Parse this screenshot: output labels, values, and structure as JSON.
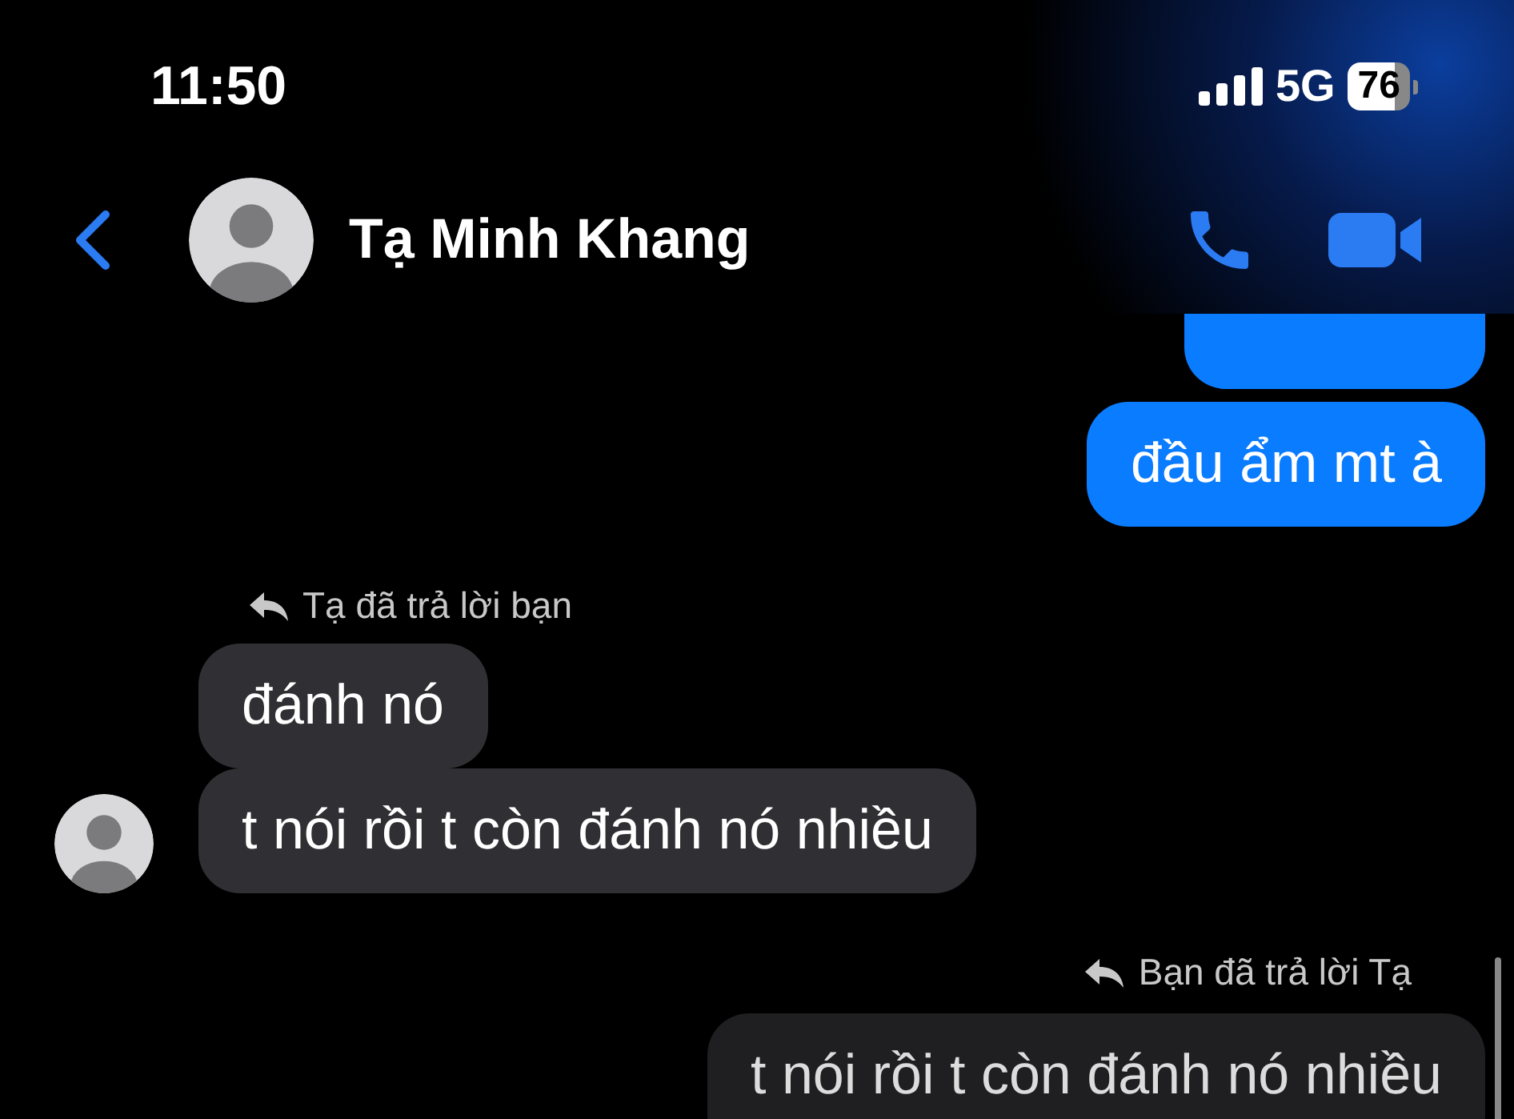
{
  "status_bar": {
    "time": "11:50",
    "network": "5G",
    "battery": "76"
  },
  "header": {
    "contact_name": "Tạ Minh Khang"
  },
  "messages": [
    {
      "kind": "sent_partial"
    },
    {
      "kind": "sent",
      "text": "đầu ẩm mt à"
    },
    {
      "kind": "reply_in",
      "text": "Tạ đã trả lời bạn"
    },
    {
      "kind": "received",
      "text": "đánh nó",
      "avatar": false
    },
    {
      "kind": "received",
      "text": "t nói rồi t còn đánh nó nhiều",
      "avatar": true
    },
    {
      "kind": "reply_out",
      "text": "Bạn đã trả lời Tạ"
    },
    {
      "kind": "quote",
      "text": "t nói rồi t còn đánh nó nhiều"
    }
  ]
}
